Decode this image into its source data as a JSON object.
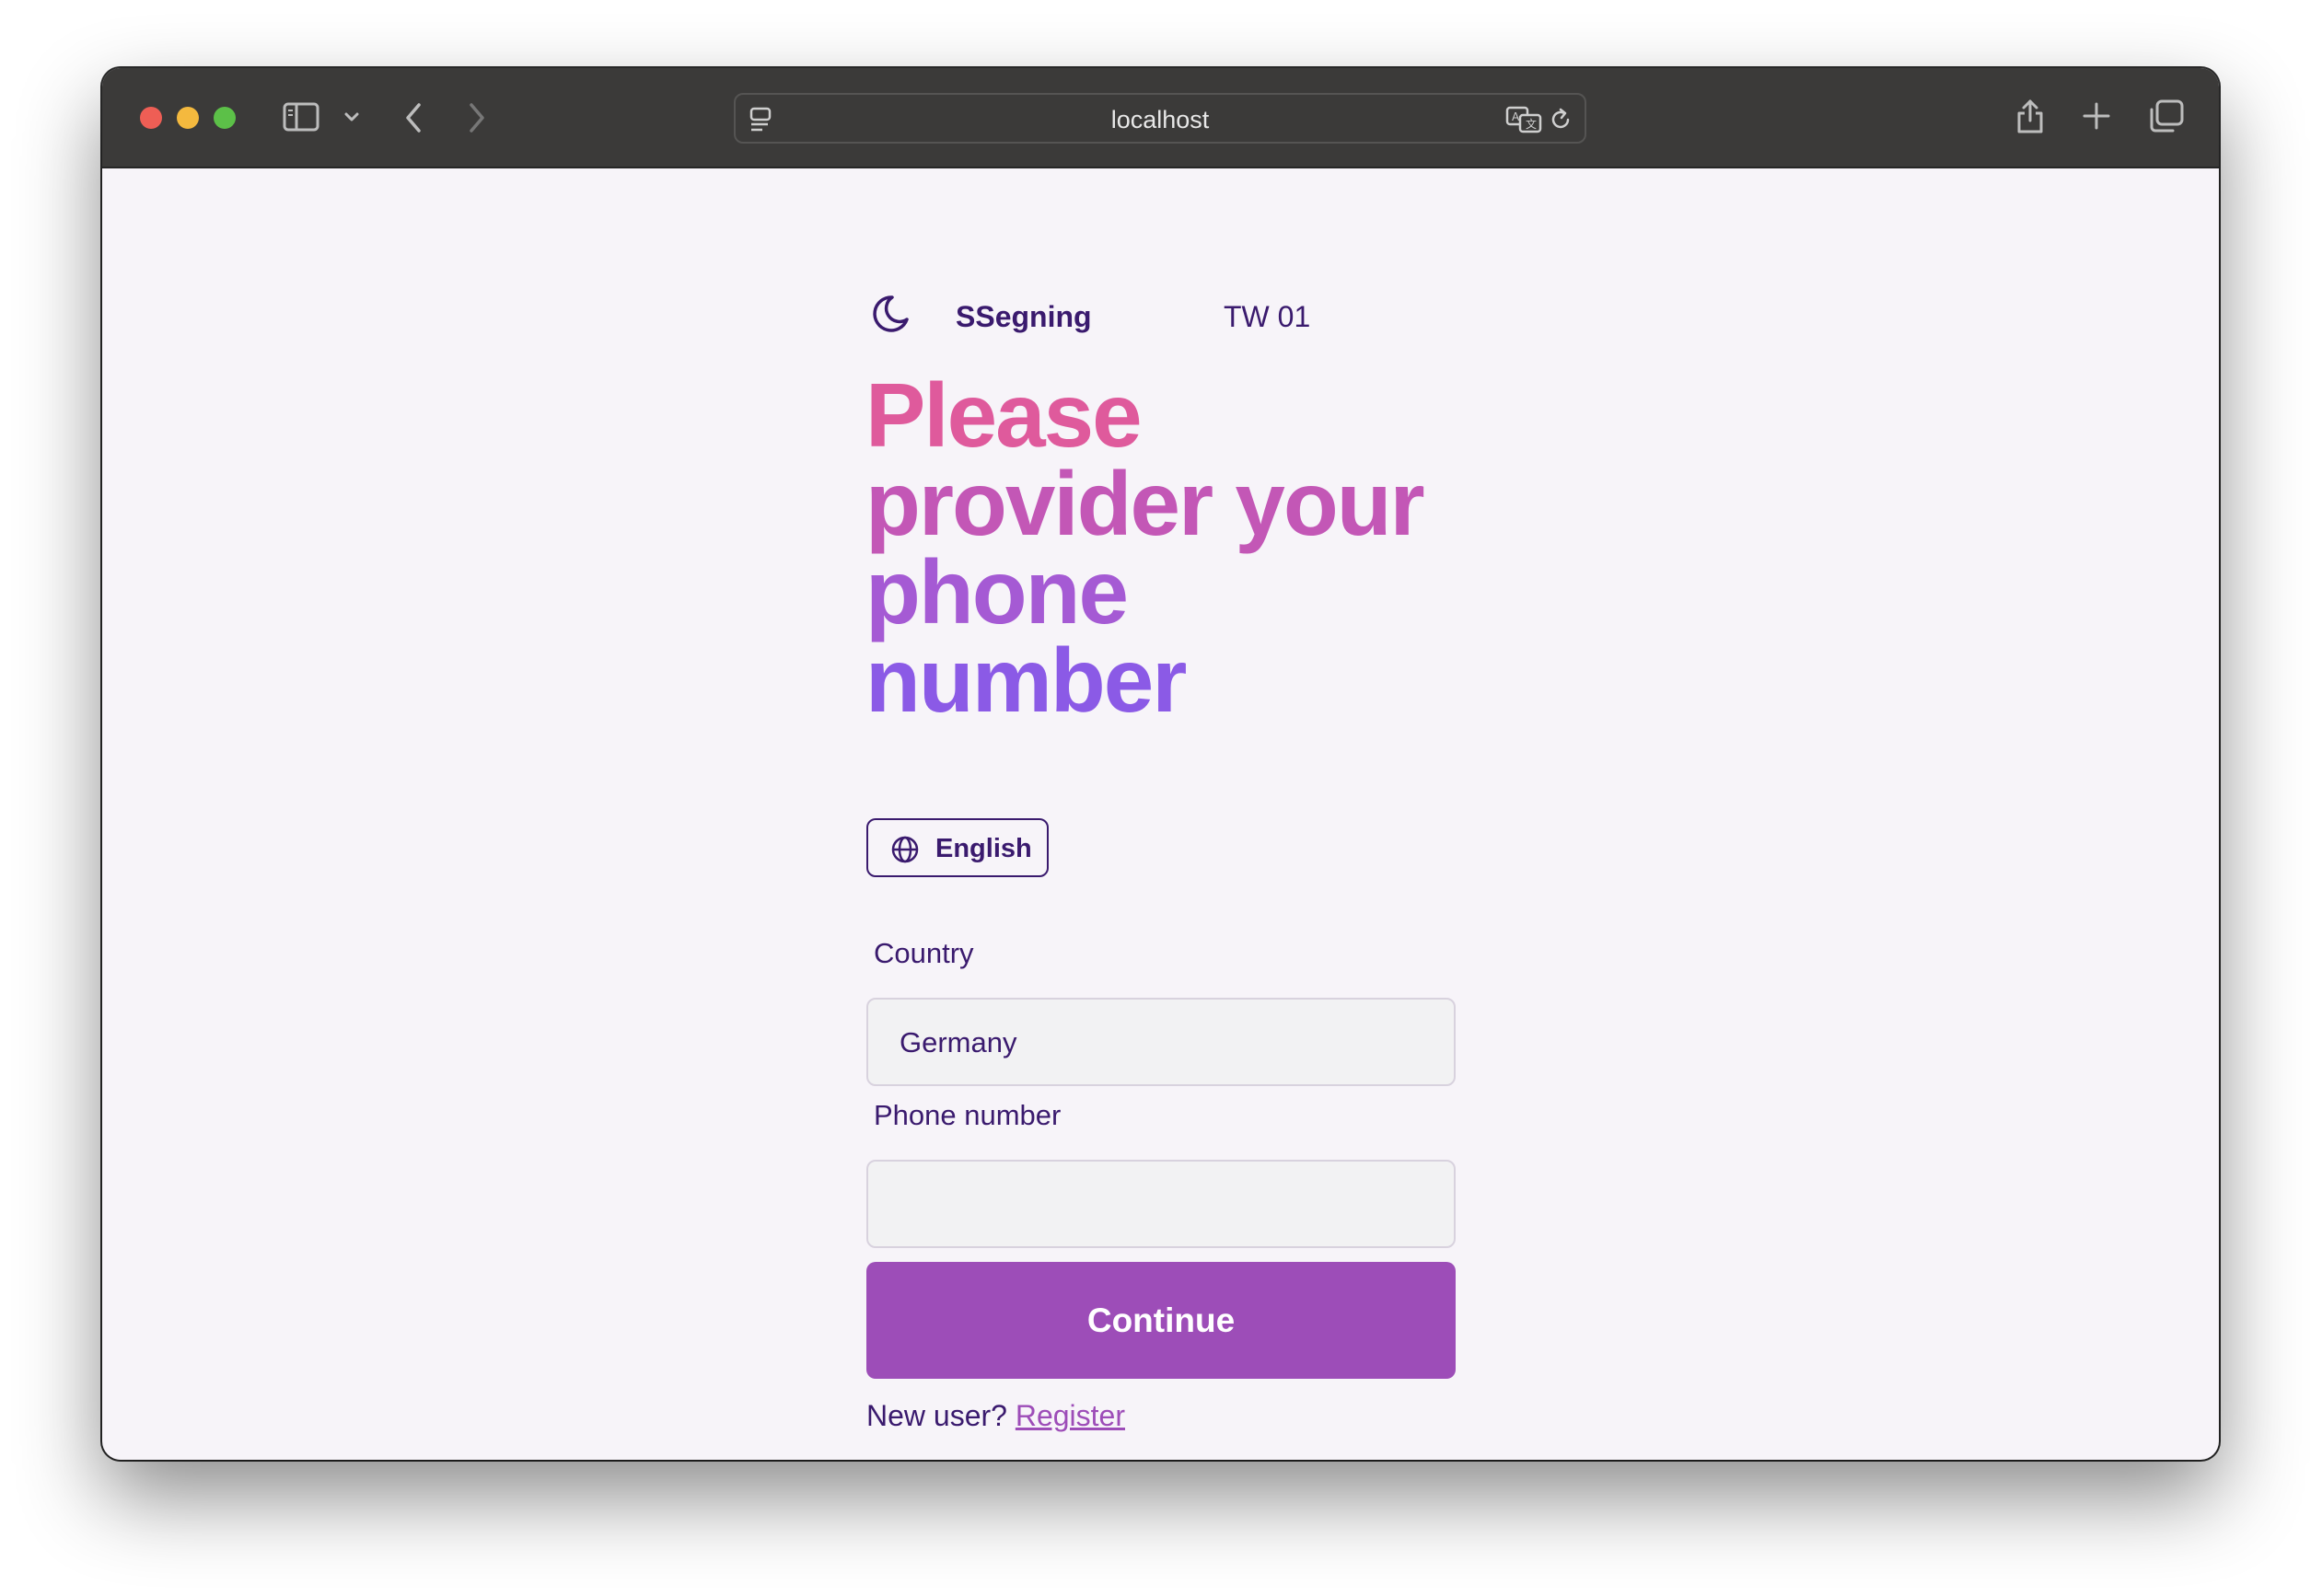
{
  "browser": {
    "url": "localhost"
  },
  "brand": {
    "name": "SSegning",
    "subtitle": "TW 01"
  },
  "heading": {
    "lines": [
      "Please",
      "provider your",
      "phone",
      "number"
    ],
    "gradient_colors": [
      "#df5a9c",
      "#b056c8",
      "#8b5ae6"
    ]
  },
  "language": {
    "label": "English"
  },
  "form": {
    "country_label": "Country",
    "country_value": "Germany",
    "phone_label": "Phone number",
    "phone_value": "",
    "submit_label": "Continue"
  },
  "footer": {
    "prompt": "New user?",
    "link": "Register"
  },
  "colors": {
    "primary": "#9d4db8",
    "text": "#3a1a6e",
    "page_bg": "#f7f4f9"
  }
}
